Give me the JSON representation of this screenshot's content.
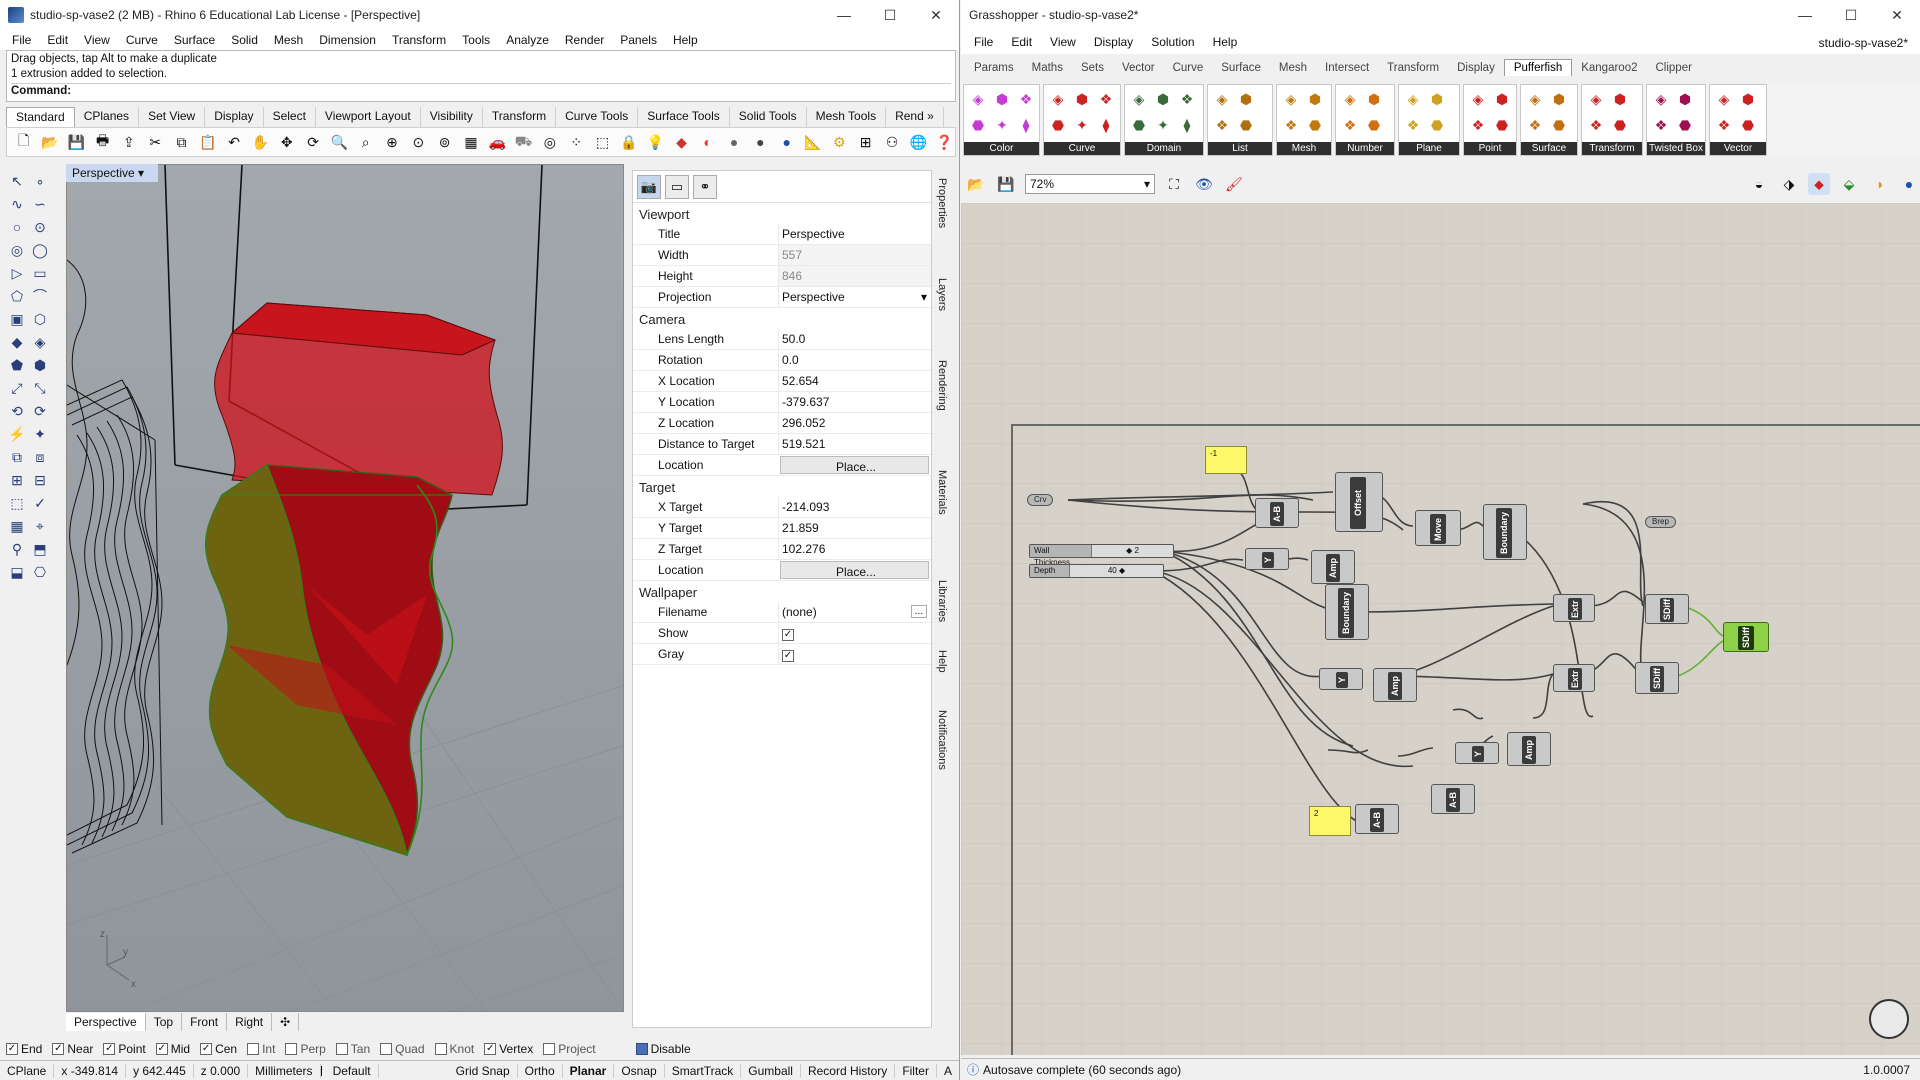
{
  "rhino": {
    "title": "studio-sp-vase2 (2 MB) - Rhino 6 Educational Lab License - [Perspective]",
    "menu": [
      "File",
      "Edit",
      "View",
      "Curve",
      "Surface",
      "Solid",
      "Mesh",
      "Dimension",
      "Transform",
      "Tools",
      "Analyze",
      "Render",
      "Panels",
      "Help"
    ],
    "history": [
      "Drag objects, tap Alt to make a duplicate",
      "1 extrusion added to selection."
    ],
    "command_label": "Command:",
    "toolbar_tabs": [
      "Standard",
      "CPlanes",
      "Set View",
      "Display",
      "Select",
      "Viewport Layout",
      "Visibility",
      "Transform",
      "Curve Tools",
      "Surface Tools",
      "Solid Tools",
      "Mesh Tools",
      "Rend »"
    ],
    "viewport_title": "Perspective",
    "viewport_tabs": [
      "Perspective",
      "Top",
      "Front",
      "Right",
      "✣"
    ],
    "axis": {
      "z": "z",
      "y": "y",
      "x": "x"
    },
    "props": {
      "sections": {
        "viewport": "Viewport",
        "camera": "Camera",
        "target": "Target",
        "wallpaper": "Wallpaper"
      },
      "viewport": [
        [
          "Title",
          "Perspective"
        ],
        [
          "Width",
          "557"
        ],
        [
          "Height",
          "846"
        ],
        [
          "Projection",
          "Perspective"
        ]
      ],
      "camera": [
        [
          "Lens Length",
          "50.0"
        ],
        [
          "Rotation",
          "0.0"
        ],
        [
          "X Location",
          "52.654"
        ],
        [
          "Y Location",
          "-379.637"
        ],
        [
          "Z Location",
          "296.052"
        ],
        [
          "Distance to Target",
          "519.521"
        ],
        [
          "Location",
          "Place..."
        ]
      ],
      "target": [
        [
          "X Target",
          "-214.093"
        ],
        [
          "Y Target",
          "21.859"
        ],
        [
          "Z Target",
          "102.276"
        ],
        [
          "Location",
          "Place..."
        ]
      ],
      "wallpaper": [
        [
          "Filename",
          "(none)"
        ],
        [
          "Show",
          ""
        ],
        [
          "Gray",
          ""
        ]
      ],
      "filename_btn": "..."
    },
    "side_panels": [
      "Properties",
      "Layers",
      "Rendering",
      "Materials",
      "Libraries",
      "Help",
      "Notifications"
    ],
    "osnap": [
      [
        "End",
        true
      ],
      [
        "Near",
        true
      ],
      [
        "Point",
        true
      ],
      [
        "Mid",
        true
      ],
      [
        "Cen",
        true
      ],
      [
        "Int",
        false
      ],
      [
        "Perp",
        false
      ],
      [
        "Tan",
        false
      ],
      [
        "Quad",
        false
      ],
      [
        "Knot",
        false
      ],
      [
        "Vertex",
        true
      ],
      [
        "Project",
        false
      ],
      [
        "Disable",
        false
      ]
    ],
    "status": [
      "CPlane",
      "x -349.814",
      "y 642.445",
      "z 0.000",
      "Millimeters",
      "Default",
      "Grid Snap",
      "Ortho",
      "Planar",
      "Osnap",
      "SmartTrack",
      "Gumball",
      "Record History",
      "Filter",
      "A"
    ]
  },
  "gh": {
    "title": "Grasshopper - studio-sp-vase2*",
    "menu": [
      "File",
      "Edit",
      "View",
      "Display",
      "Solution",
      "Help"
    ],
    "doc_name": "studio-sp-vase2*",
    "tabs": [
      "Params",
      "Maths",
      "Sets",
      "Vector",
      "Curve",
      "Surface",
      "Mesh",
      "Intersect",
      "Transform",
      "Display",
      "Pufferfish",
      "Kangaroo2",
      "Clipper"
    ],
    "active_tab": "Pufferfish",
    "groups": [
      "Color",
      "Curve",
      "Domain",
      "List",
      "Mesh",
      "Number",
      "Plane",
      "Point",
      "Surface",
      "Transform",
      "Twisted Box",
      "Vector"
    ],
    "zoom": "72%",
    "status": "Autosave complete (60 seconds ago)",
    "version": "1.0.0007",
    "nodes": {
      "crv": "Crv",
      "brep": "Brep",
      "wall": "Wall Thickness",
      "wall_val": "◆ 2",
      "depth": "Depth",
      "depth_val": "40 ◆",
      "panel1": "-1",
      "panel2": "2",
      "offset": "Offset",
      "move": "Move",
      "boundary1": "Boundary",
      "boundary2": "Boundary",
      "ab1": "A-B",
      "ab2": "A-B",
      "ab3": "A-B",
      "amp1": "Amp",
      "amp2": "Amp",
      "amp3": "Amp",
      "y1": "Y",
      "y2": "Y",
      "y3": "Y",
      "extr1": "Extr",
      "extr2": "Extr",
      "sdiff1": "SDiff",
      "sdiff2": "SDiff",
      "sdiff3": "SDiff"
    }
  }
}
